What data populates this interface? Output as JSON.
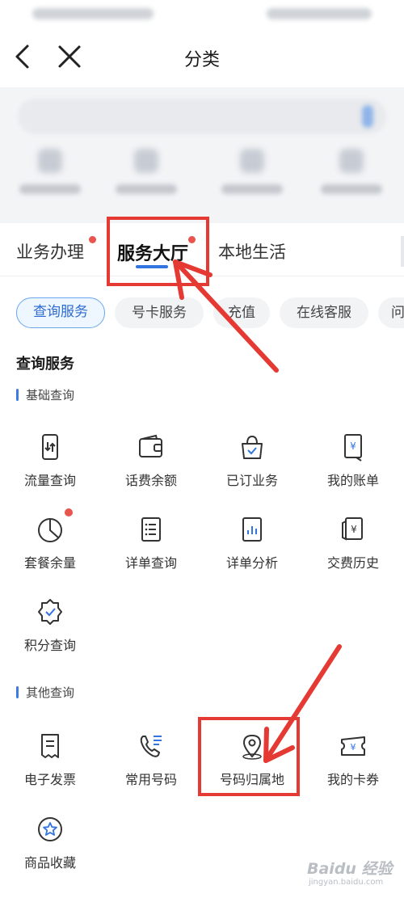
{
  "nav": {
    "title": "分类"
  },
  "main_tabs": [
    "业务办理",
    "服务大厅",
    "本地生活"
  ],
  "chips": [
    "查询服务",
    "号卡服务",
    "充值",
    "在线客服",
    "问"
  ],
  "section_title": "查询服务",
  "basic": {
    "title": "基础查询",
    "items": [
      "流量查询",
      "话费余额",
      "已订业务",
      "我的账单",
      "套餐余量",
      "详单查询",
      "详单分析",
      "交费历史",
      "积分查询"
    ]
  },
  "other": {
    "title": "其他查询",
    "items": [
      "电子发票",
      "常用号码",
      "号码归属地",
      "我的卡券",
      "商品收藏"
    ]
  },
  "icons": {
    "basic": [
      "traffic-phone-icon",
      "wallet-icon",
      "subscribed-bag-icon",
      "bill-yuan-icon",
      "pie-chart-icon",
      "list-icon",
      "bar-chart-icon",
      "payment-yuan-icon",
      "badge-check-icon"
    ],
    "other": [
      "invoice-icon",
      "phone-list-icon",
      "location-pin-icon",
      "ticket-yuan-icon",
      "star-favorite-icon"
    ]
  },
  "colors": {
    "accent": "#3274e0",
    "badge": "#e8544e",
    "annotation": "#e53a33"
  },
  "watermark": {
    "text": "Baidu 经验",
    "subtext": "jingyan.baidu.com"
  }
}
